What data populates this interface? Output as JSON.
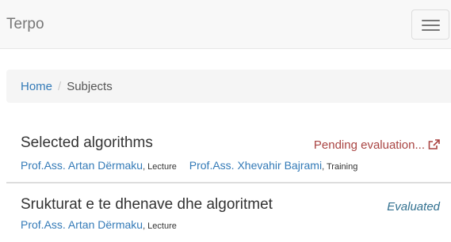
{
  "navbar": {
    "brand": "Terpo",
    "toggle_icon": "hamburger-menu-icon"
  },
  "breadcrumb": {
    "home": "Home",
    "separator": "/",
    "current": "Subjects"
  },
  "subjects": [
    {
      "title": "Selected algorithms",
      "status": "Pending evaluation...",
      "status_icon": "external-link-icon",
      "status_color": "#a94442",
      "teachers": [
        {
          "name": "Prof.Ass. Artan Dërmaku",
          "type": ", Lecture"
        },
        {
          "name": "Prof.Ass. Xhevahir Bajrami",
          "type": ", Training"
        }
      ]
    },
    {
      "title": "Srukturat e te dhenave dhe algoritmet",
      "status": "Evaluated",
      "status_color": "#31708f",
      "teachers": [
        {
          "name": "Prof.Ass. Artan Dërmaku",
          "type": ", Lecture"
        }
      ]
    }
  ],
  "colors": {
    "link": "#337ab7",
    "navbar_bg": "#f8f8f8",
    "breadcrumb_bg": "#f5f5f5"
  }
}
